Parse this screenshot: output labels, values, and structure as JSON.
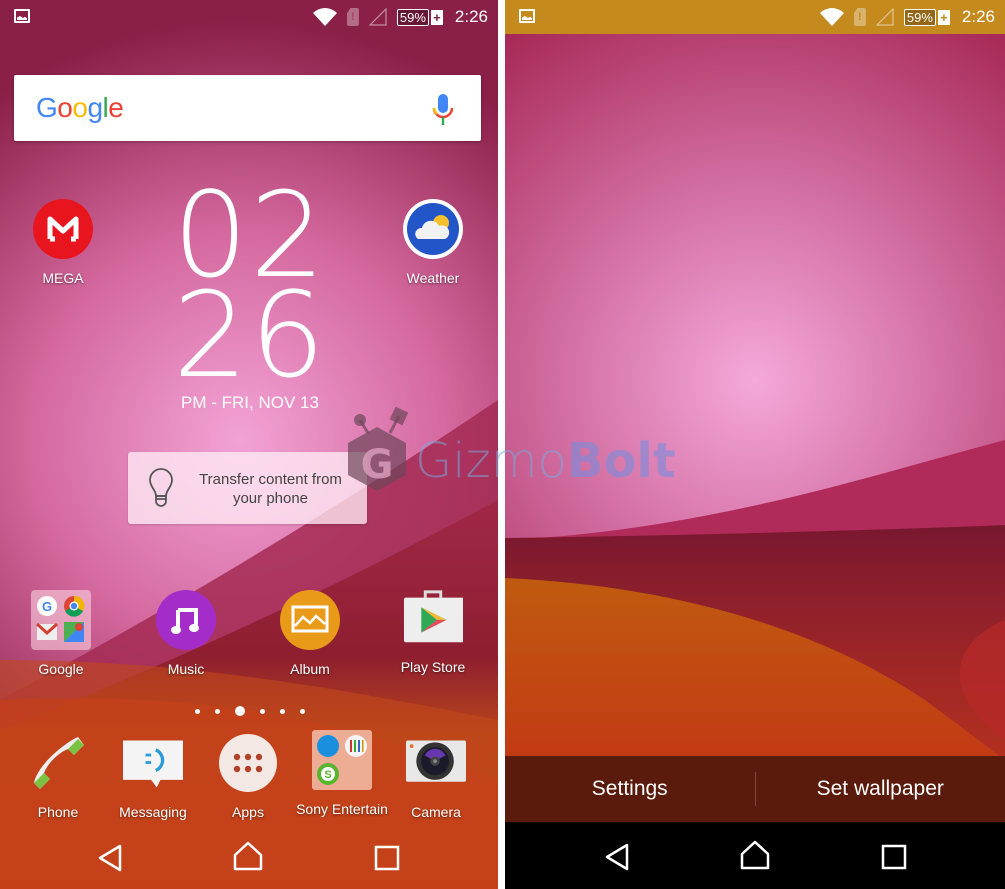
{
  "status_bar": {
    "battery_percent": "59%",
    "battery_charging_symbol": "+",
    "time": "2:26",
    "icons": [
      "gallery-notification-icon",
      "wifi-icon",
      "sim-alert-icon",
      "signal-icon",
      "battery-icon"
    ],
    "left_color": "#7a1a3a",
    "right_color": "#c48a1e"
  },
  "left_screen": {
    "search": {
      "logo": "Google",
      "mic_icon": "mic-icon"
    },
    "clock": {
      "hours": "02",
      "minutes": "26",
      "date": "PM - FRI, NOV 13"
    },
    "top_apps": [
      {
        "label": "MEGA",
        "icon": "mega-icon"
      },
      {
        "label": "Weather",
        "icon": "weather-icon"
      }
    ],
    "tip_card": {
      "text": "Transfer content from your phone",
      "icon": "lightbulb-icon"
    },
    "row_apps": [
      {
        "label": "Google",
        "icon": "google-folder-icon"
      },
      {
        "label": "Music",
        "icon": "music-icon"
      },
      {
        "label": "Album",
        "icon": "album-icon"
      },
      {
        "label": "Play Store",
        "icon": "play-store-icon"
      }
    ],
    "page_indicator": {
      "pages": 6,
      "active_index": 2
    },
    "dock": [
      {
        "label": "Phone",
        "icon": "phone-icon"
      },
      {
        "label": "Messaging",
        "icon": "messaging-icon"
      },
      {
        "label": "Apps",
        "icon": "apps-icon"
      },
      {
        "label": "Sony Entertain",
        "icon": "sony-folder-icon"
      },
      {
        "label": "Camera",
        "icon": "camera-icon"
      }
    ]
  },
  "right_screen": {
    "actions": {
      "settings": "Settings",
      "set_wallpaper": "Set wallpaper"
    }
  },
  "navigation": [
    "back-icon",
    "home-icon",
    "recents-icon"
  ],
  "watermark": {
    "light": "Gizmo",
    "bold": "Bolt"
  }
}
